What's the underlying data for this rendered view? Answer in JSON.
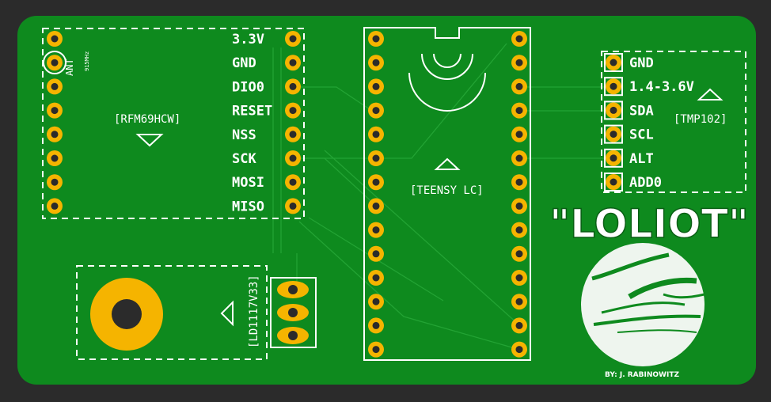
{
  "board": {
    "colors": {
      "background": "#2b2b2b",
      "pcb": "#0e8a1e",
      "trace": "#23a334",
      "pad": "#f5b400",
      "silk": "#ffffff"
    }
  },
  "rfm": {
    "ref": "[RFM69HCW]",
    "ant_label": "ANT",
    "freq_label": "915MHz",
    "pins": [
      "3.3V",
      "GND",
      "DIO0",
      "RESET",
      "NSS",
      "SCK",
      "MOSI",
      "MISO"
    ]
  },
  "teensy": {
    "ref": "[TEENSY LC]"
  },
  "tmp": {
    "ref": "[TMP102]",
    "pins": [
      "GND",
      "1.4-3.6V",
      "SDA",
      "SCL",
      "ALT",
      "ADD0"
    ]
  },
  "regulator": {
    "ref": "[LD1117V33]"
  },
  "logo": {
    "title": "\"LOLIOT\"",
    "byline": "BY: J. RABINOWITZ"
  }
}
